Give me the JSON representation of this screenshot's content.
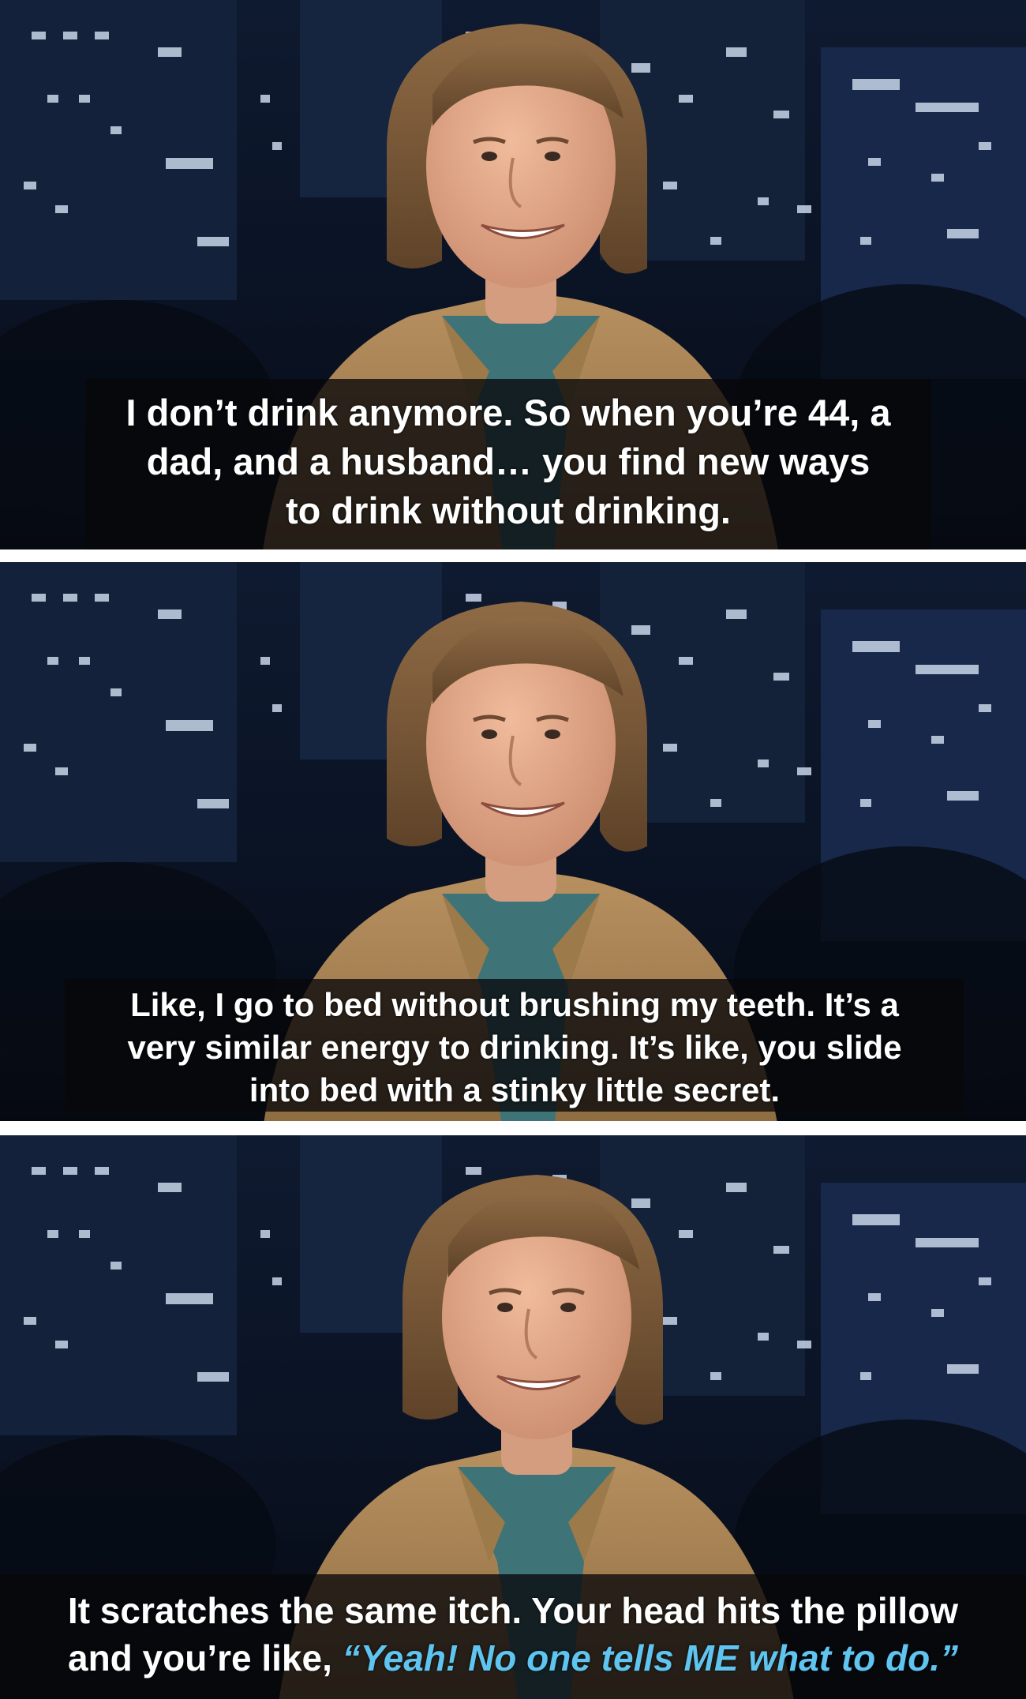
{
  "panels": [
    {
      "caption": [
        "I don’t drink anymore. So when you’re 44, a",
        "dad, and a husband… you find new ways",
        "to drink without drinking."
      ]
    },
    {
      "caption": [
        "Like, I go to bed without brushing my teeth. It’s a",
        "very similar energy to drinking. It’s like, you slide",
        "into bed with a stinky little secret."
      ]
    },
    {
      "caption_line1": "It scratches the same itch. Your head hits the pillow",
      "caption_line2_plain": "and you’re like, ",
      "caption_line2_quote": "“Yeah! No one tells ME what to do.”"
    }
  ],
  "colors": {
    "background_divider": "#ffffff",
    "night_sky": "#0b1426",
    "city_lights": "#c9d6ea",
    "jacket": "#a9844f",
    "shirt": "#3e7378",
    "hair": "#7a5a3a",
    "skin": "#e2a98a",
    "caption_text": "#ffffff",
    "quote_text": "#5fc4f0"
  }
}
